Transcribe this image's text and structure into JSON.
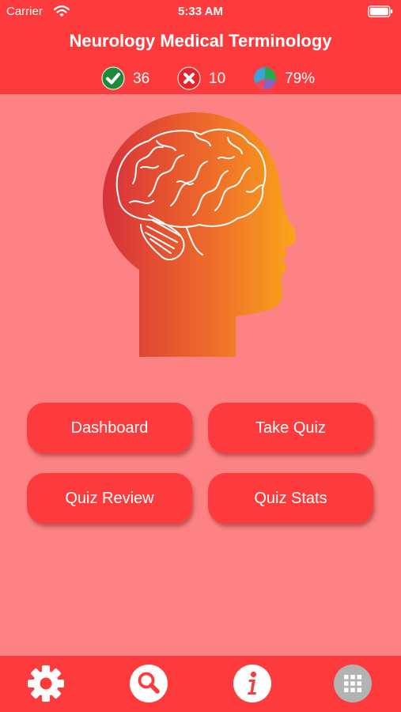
{
  "status_bar": {
    "carrier": "Carrier",
    "time": "5:33 AM"
  },
  "header": {
    "title": "Neurology Medical Terminology"
  },
  "stats": {
    "correct": "36",
    "wrong": "10",
    "score": "79%"
  },
  "menu": {
    "dashboard": "Dashboard",
    "take_quiz": "Take Quiz",
    "quiz_review": "Quiz Review",
    "quiz_stats": "Quiz Stats"
  },
  "tabbar": {
    "items": [
      "gear-icon",
      "search-icon",
      "info-icon",
      "grid-icon"
    ]
  },
  "colors": {
    "header": "#fd3b3c",
    "background": "#fd8283",
    "button": "#fd3b3c",
    "correct": "#1e8b3a",
    "wrong": "#e8242b",
    "head_gradient_start": "#d7303a",
    "head_gradient_end": "#f9a51b"
  }
}
